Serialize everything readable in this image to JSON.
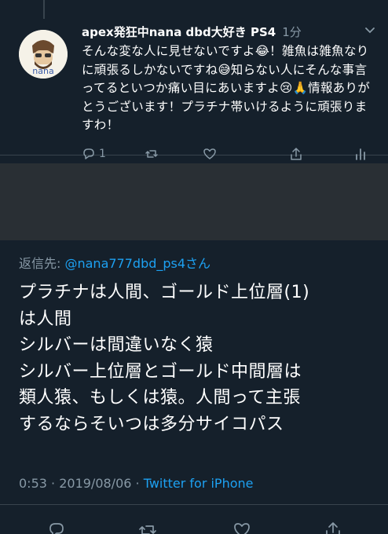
{
  "reply": {
    "display_name": "apex発狂中nana dbd大好き PS4",
    "time": "1分",
    "text": "そんな変な人に見せないですよ😂！雑魚は雑魚なりに頑張るしかないですね😅知らない人にそんな事言ってるといつか痛い目にあいますよ😢🙏情報ありがとうございます！プラチナ帯いけるように頑張りますわ！",
    "reply_count": "1",
    "avatar_text": "nana"
  },
  "main": {
    "reply_label": "返信先: ",
    "reply_mention": "@nana777dbd_ps4さん",
    "text_lines": [
      "プラチナは人間、ゴールド上位層(1)",
      "は人間",
      "シルバーは間違いなく猿",
      "シルバー上位層とゴールド中間層は",
      "類人猿、もしくは猿。人間って主張",
      "するならそいつは多分サイコパス"
    ],
    "time": "0:53",
    "date": "2019/08/06",
    "separator": " · ",
    "source": "Twitter for iPhone"
  },
  "colors": {
    "background": "#15202b",
    "accent": "#1da1f2",
    "muted": "#8899a6",
    "redacted": "#292f34"
  },
  "icons": [
    "more-chevron-icon",
    "reply-icon",
    "retweet-icon",
    "like-icon",
    "analytics-icon",
    "share-icon"
  ]
}
